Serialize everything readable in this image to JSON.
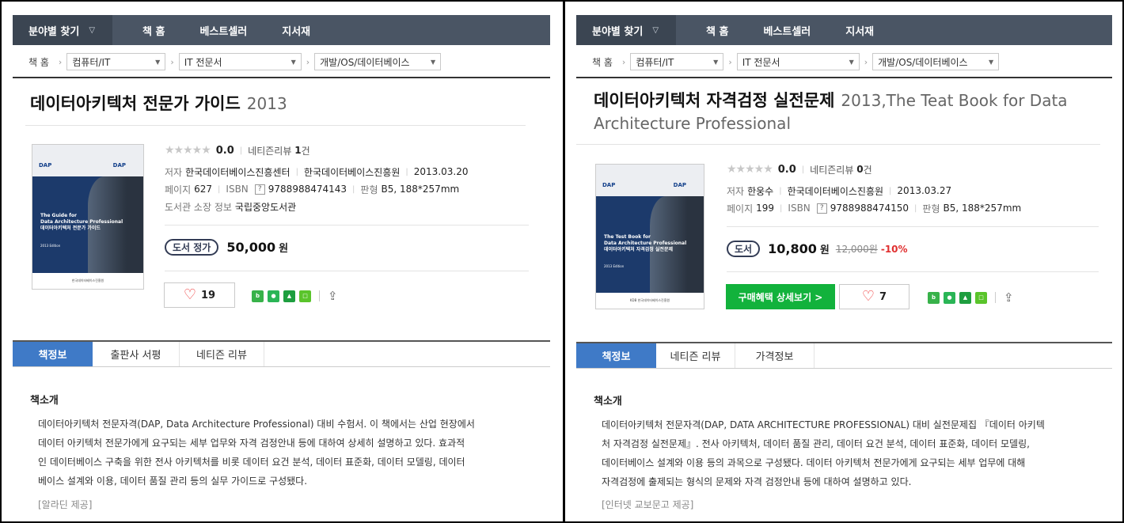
{
  "left": {
    "nav": {
      "category": "분야별 찾기",
      "links": [
        "책 홈",
        "베스트셀러",
        "지서재"
      ]
    },
    "breadcrumb": {
      "home": "책 홈",
      "levels": [
        "컴퓨터/IT",
        "IT 전문서",
        "개발/OS/데이터베이스"
      ]
    },
    "title": "데이터아키텍처 전문가 가이드",
    "subtitle": "2013",
    "cover": {
      "series": "DAP",
      "title_lines": [
        "The Guide for",
        "Data Architecture Professional"
      ],
      "ko_title": "데이터아키텍처 전문가 가이드",
      "edition": "2013 Edition",
      "publisher": "한국데이터베이스진흥원"
    },
    "rating": {
      "score": "0.0",
      "review_label": "네티즌리뷰",
      "review_count": "1",
      "review_unit": "건"
    },
    "author_label": "저자",
    "author": "한국데이터베이스진흥센터",
    "publisher": "한국데이터베이스진흥원",
    "date": "2013.03.20",
    "pages_label": "페이지",
    "pages": "627",
    "isbn_label": "ISBN",
    "isbn": "9788988474143",
    "format_label": "판형",
    "format": "B5, 188*257mm",
    "library_label": "도서관 소장 정보",
    "library": "국립중앙도서관",
    "price": {
      "badge": "도서 정가",
      "amount": "50,000",
      "unit": "원"
    },
    "likes": "19",
    "tabs": [
      "책정보",
      "출판사 서평",
      "네티즌 리뷰"
    ],
    "intro_heading": "책소개",
    "intro_lines": [
      "데이터아키텍처 전문자격(DAP, Data Architecture Professional) 대비 수험서. 이 책에서는 산업 현장에서",
      "데이터 아키텍처 전문가에게 요구되는 세부 업무와 자격 검정안내 등에 대하여 상세히 설명하고 있다. 효과적",
      "인 데이터베이스 구축을 위한 전사 아키텍처를 비롯 데이터 요건 분석, 데이터 표준화, 데이터 모델링, 데이터",
      "베이스 설계와 이용, 데이터 품질 관리 등의 실무 가이드로 구성됐다."
    ],
    "source": "[알라딘 제공]"
  },
  "right": {
    "nav": {
      "category": "분야별 찾기",
      "links": [
        "책 홈",
        "베스트셀러",
        "지서재"
      ]
    },
    "breadcrumb": {
      "home": "책 홈",
      "levels": [
        "컴퓨터/IT",
        "IT 전문서",
        "개발/OS/데이터베이스"
      ]
    },
    "title": "데이터아키텍처 자격검정 실전문제",
    "subtitle_line1": "2013,The Teat Book for Data",
    "subtitle_line2": "Architecture Professional",
    "cover": {
      "series": "DAP",
      "title_lines": [
        "The Test Book for",
        "Data Architecture Professional"
      ],
      "ko_title": "데이터아키텍처 자격검정 실전문제",
      "edition": "2013 Edition",
      "publisher": "KDB 한국데이터베이스진흥원"
    },
    "rating": {
      "score": "0.0",
      "review_label": "네티즌리뷰",
      "review_count": "0",
      "review_unit": "건"
    },
    "author_label": "저자",
    "author": "한웅수",
    "publisher": "한국데이터베이스진흥원",
    "date": "2013.03.27",
    "pages_label": "페이지",
    "pages": "199",
    "isbn_label": "ISBN",
    "isbn": "9788988474150",
    "format_label": "판형",
    "format": "B5, 188*257mm",
    "price": {
      "badge": "도서",
      "amount": "10,800",
      "unit": "원",
      "original": "12,000원",
      "discount": "-10%"
    },
    "buy_button": "구매혜택 상세보기 >",
    "likes": "7",
    "tabs": [
      "책정보",
      "네티즌 리뷰",
      "가격정보"
    ],
    "intro_heading": "책소개",
    "intro_lines": [
      "데이터아키텍처 전문자격(DAP, DATA ARCHITECTURE PROFESSIONAL) 대비 실전문제집 『데이터 아키텍",
      "처 자격검정 실전문제』. 전사 아키텍처, 데이터 품질 관리, 데이터 요건 분석, 데이터 표준화, 데이터 모델링,",
      "데이터베이스 설계와 이용 등의 과목으로 구성됐다. 데이터 아키텍처 전문가에게 요구되는 세부 업무에 대해",
      "자격검정에 출제되는 형식의 문제와 자격 검정안내 등에 대하여 설명하고 있다."
    ],
    "source": "[인터넷 교보문고 제공]"
  },
  "stars": "★★★★★",
  "sns_icons": [
    "blog-icon",
    "band-icon",
    "bookmark-icon",
    "note-icon"
  ],
  "colors": {
    "nav_bg": "#4a5564",
    "tab_active": "#3f7ac7",
    "buy_green": "#12b23c",
    "discount_red": "#e03030"
  }
}
